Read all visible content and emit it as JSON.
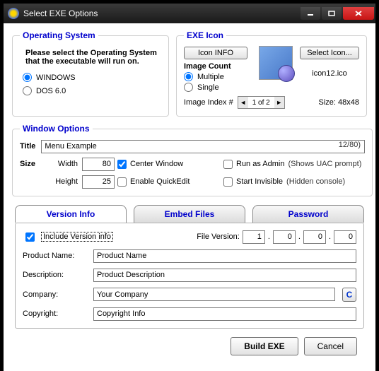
{
  "window": {
    "title": "Select EXE Options"
  },
  "os": {
    "legend": "Operating System",
    "instruction": "Please select the Operating System that the executable will run on.",
    "opt_windows": "WINDOWS",
    "opt_dos": "DOS 6.0"
  },
  "icon": {
    "legend": "EXE Icon",
    "info_btn": "Icon INFO",
    "select_btn": "Select Icon...",
    "image_count_label": "Image Count",
    "opt_multiple": "Multiple",
    "opt_single": "Single",
    "index_label": "Image Index #",
    "index_value": "1 of 2",
    "filename": "icon12.ico",
    "size_label": "Size: 48x48"
  },
  "winopts": {
    "legend": "Window Options",
    "title_label": "Title",
    "title_value": "Menu Example",
    "title_count": "12/80)",
    "size_label": "Size",
    "width_label": "Width",
    "width_value": "80",
    "height_label": "Height",
    "height_value": "25",
    "center": "Center Window",
    "quickedit": "Enable QuickEdit",
    "runadmin": "Run as Admin",
    "runadmin_note": "(Shows UAC prompt)",
    "invisible": "Start Invisible",
    "invisible_note": "(Hidden console)"
  },
  "tabs": {
    "version": "Version Info",
    "embed": "Embed Files",
    "password": "Password"
  },
  "version": {
    "include": "Include Version info",
    "file_version_label": "File Version:",
    "fv1": "1",
    "fv2": "0",
    "fv3": "0",
    "fv4": "0",
    "product_label": "Product Name:",
    "product_value": "Product Name",
    "desc_label": "Description:",
    "desc_value": "Product Description",
    "company_label": "Company:",
    "company_value": "Your Company",
    "copyright_label": "Copyright:",
    "copyright_value": "Copyright Info",
    "cbtn": "C"
  },
  "footer": {
    "build": "Build EXE",
    "cancel": "Cancel"
  }
}
